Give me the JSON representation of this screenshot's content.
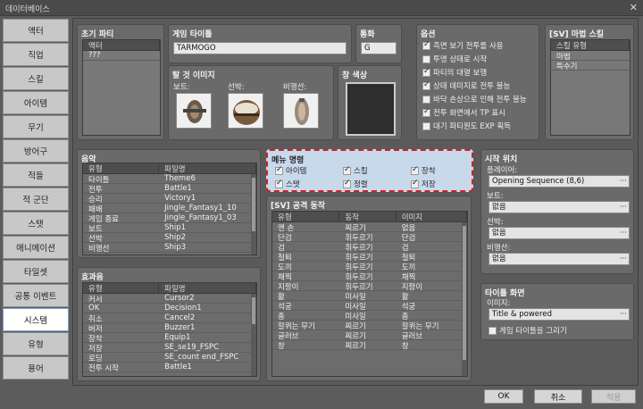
{
  "window": {
    "title": "데이터베이스",
    "close": "✕"
  },
  "tabs": [
    "액터",
    "직업",
    "스킬",
    "아이템",
    "무기",
    "방어구",
    "적들",
    "적 군단",
    "스탯",
    "애니메이션",
    "타일셋",
    "공통 이벤트",
    "시스템",
    "유형",
    "용어"
  ],
  "selected_tab": "시스템",
  "initial_party": {
    "title": "초기 파티",
    "header": "액터",
    "rows": [
      "???"
    ]
  },
  "game_title": {
    "title": "게임 타이틀",
    "value": "TARMOGO"
  },
  "currency": {
    "title": "통화",
    "value": "G"
  },
  "options": {
    "title": "옵션",
    "items": [
      {
        "label": "측면 보기 전투를 사용",
        "checked": true
      },
      {
        "label": "투명 상태로 시작",
        "checked": false
      },
      {
        "label": "파티의 대열 보행",
        "checked": true
      },
      {
        "label": "상태 데미지로 전투 불능",
        "checked": true
      },
      {
        "label": "바닥 손상으로 인해 전투 불능",
        "checked": false
      },
      {
        "label": "전투 화면에서 TP 표시",
        "checked": true
      },
      {
        "label": "대기 파티원도 EXP 획득",
        "checked": false
      }
    ]
  },
  "magic_skill": {
    "title": "[SV] 마법 스킬",
    "header": "스킬 유형",
    "rows": [
      "마법",
      "특수기"
    ]
  },
  "vehicle_images": {
    "title": "탈 것 이미지",
    "boat": "보트:",
    "ship": "선박:",
    "airship": "비행선:"
  },
  "window_color": {
    "title": "창 색상"
  },
  "music": {
    "title": "음악",
    "col1": "유형",
    "col2": "파일명",
    "rows": [
      [
        "타이틀",
        "Theme6"
      ],
      [
        "전투",
        "Battle1"
      ],
      [
        "승리",
        "Victory1"
      ],
      [
        "패배",
        "Jingle_Fantasy1_10"
      ],
      [
        "게임 종료",
        "Jingle_Fantasy1_03"
      ],
      [
        "보트",
        "Ship1"
      ],
      [
        "선박",
        "Ship2"
      ],
      [
        "비행선",
        "Ship3"
      ]
    ]
  },
  "sound": {
    "title": "효과음",
    "col1": "유형",
    "col2": "파일명",
    "rows": [
      [
        "커서",
        "Cursor2"
      ],
      [
        "OK",
        "Decision1"
      ],
      [
        "취소",
        "Cancel2"
      ],
      [
        "버저",
        "Buzzer1"
      ],
      [
        "장착",
        "Equip1"
      ],
      [
        "저장",
        "SE_se19_FSPC"
      ],
      [
        "로딩",
        "SE_count end_FSPC"
      ],
      [
        "전투 시작",
        "Battle1"
      ]
    ]
  },
  "menu_commands": {
    "title": "메뉴 명령",
    "items": [
      {
        "label": "아이템",
        "checked": true
      },
      {
        "label": "스킬",
        "checked": true
      },
      {
        "label": "장착",
        "checked": true
      },
      {
        "label": "스탯",
        "checked": true
      },
      {
        "label": "정렬",
        "checked": true
      },
      {
        "label": "저장",
        "checked": true
      }
    ]
  },
  "attack_motion": {
    "title": "[SV] 공격 동작",
    "col1": "유형",
    "col2": "동작",
    "col3": "이미지",
    "rows": [
      [
        "맨 손",
        "찌르기",
        "없음"
      ],
      [
        "단검",
        "휘두르기",
        "단검"
      ],
      [
        "검",
        "휘두르기",
        "검"
      ],
      [
        "철퇴",
        "휘두르기",
        "철퇴"
      ],
      [
        "도끼",
        "휘두르기",
        "도끼"
      ],
      [
        "채찍",
        "휘두르기",
        "채찍"
      ],
      [
        "지팡이",
        "휘두르기",
        "지팡이"
      ],
      [
        "활",
        "미사일",
        "활"
      ],
      [
        "석궁",
        "미사일",
        "석궁"
      ],
      [
        "총",
        "미사일",
        "총"
      ],
      [
        "할퀴는 무기",
        "찌르기",
        "할퀴는 무기"
      ],
      [
        "글러브",
        "찌르기",
        "글러브"
      ],
      [
        "창",
        "찌르기",
        "창"
      ]
    ]
  },
  "start_position": {
    "title": "시작 위치",
    "player_label": "플레이어:",
    "player": "Opening Sequence (8,6)",
    "boat_label": "보트:",
    "boat": "없음",
    "ship_label": "선박:",
    "ship": "없음",
    "airship_label": "비행선:",
    "airship": "없음"
  },
  "title_screen": {
    "title": "타이틀 화면",
    "image_label": "이미지:",
    "image": "Title & powered",
    "draw_label": "게임 타이틀을 그리기",
    "draw_checked": false
  },
  "buttons": {
    "ok": "OK",
    "cancel": "취소",
    "apply": "적용"
  },
  "dots": "···"
}
